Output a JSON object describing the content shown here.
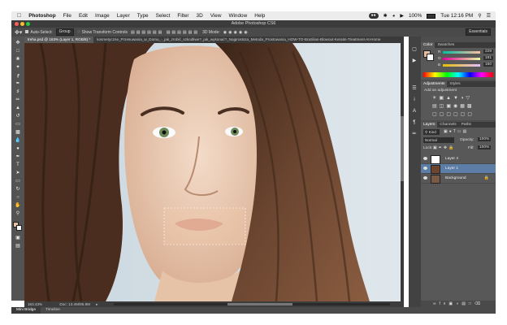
{
  "menubar": {
    "apple": "",
    "app": "Photoshop",
    "items": [
      "File",
      "Edit",
      "Image",
      "Layer",
      "Type",
      "Select",
      "Filter",
      "3D",
      "View",
      "Window",
      "Help"
    ],
    "battery": "100%",
    "clock": "Tue 12:16 PM"
  },
  "window": {
    "title": "Adobe Photoshop CS6"
  },
  "options": {
    "auto_select": "Auto-Select:",
    "auto_select_value": "Group",
    "transform": "Show Transform Controls",
    "mode_3d": "3D Mode:",
    "workspace": "Essentials"
  },
  "tabs": [
    {
      "label": "treha.psd @ 163% (Layer 1, RGB/8) *",
      "active": true
    },
    {
      "label": "kosmetyczne_Przesuwania_w_Domu_-_jak_zrobić_szkodliwe?_jak_wykonać?_Najprostsza_Metoda_Prostowania_HOW-TO-Brazilian-Blowout-Keratin-Treatment-At-Home",
      "active": false
    }
  ],
  "status": {
    "zoom": "163.43%",
    "doc": "Doc: 13.4M/95.8M"
  },
  "bottom_tabs": [
    "Mini Bridge",
    "Timeline"
  ],
  "color_panel": {
    "tabs": [
      "Color",
      "Swatches"
    ],
    "r_label": "R",
    "g_label": "G",
    "b_label": "B",
    "r": "229",
    "g": "191",
    "b": "160"
  },
  "adjustments_panel": {
    "tabs": [
      "Adjustments",
      "Styles"
    ],
    "add_label": "Add an adjustment"
  },
  "layers_panel": {
    "tabs": [
      "Layers",
      "Channels",
      "Paths"
    ],
    "kind": "Kind",
    "blend": "Normal",
    "opacity_label": "Opacity:",
    "opacity": "100%",
    "lock_label": "Lock:",
    "fill_label": "Fill:",
    "fill": "100%",
    "layers": [
      {
        "name": "Layer 4",
        "selected": false,
        "visible": true
      },
      {
        "name": "Layer 1",
        "selected": true,
        "visible": true
      },
      {
        "name": "Background",
        "selected": false,
        "visible": true
      }
    ]
  },
  "colors": {
    "panel": "#535353",
    "dark": "#3a3a3a",
    "selection": "#5b7da6",
    "foreground_swatch": "#e5bfa0"
  }
}
